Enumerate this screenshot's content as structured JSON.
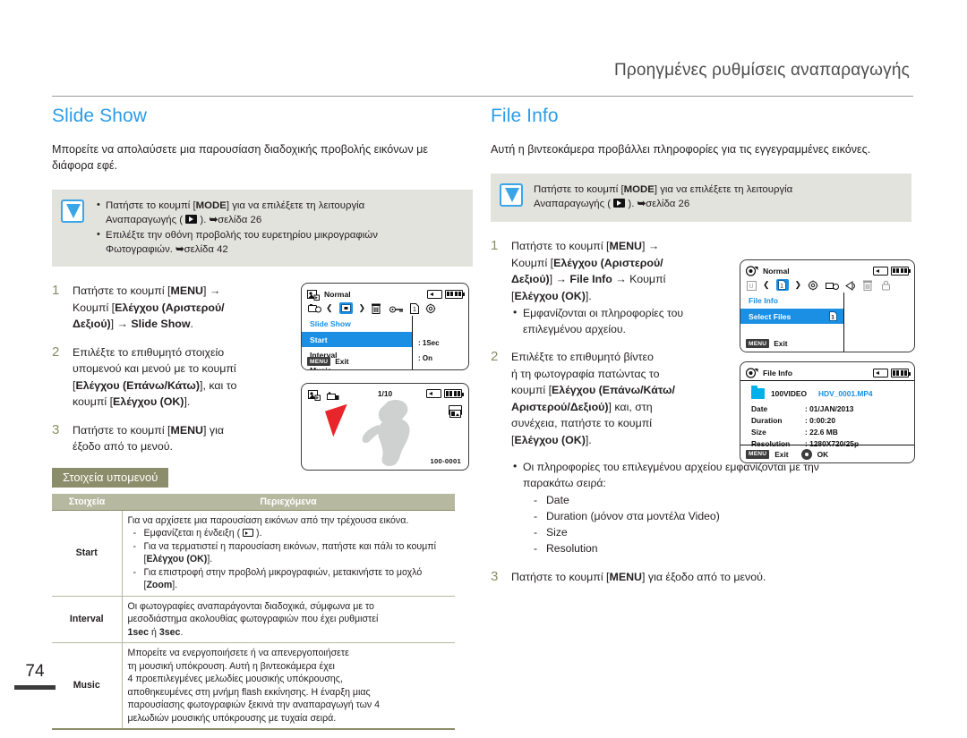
{
  "header": {
    "title": "Προηγμένες ρυθμίσεις αναπαραγωγής"
  },
  "page_number": "74",
  "colors": {
    "accent": "#2b9de8",
    "lcd_highlight": "#1a8fe3",
    "table_header": "#b7b8a0",
    "tag": "#8c8d6a"
  },
  "left": {
    "section_title": "Slide Show",
    "intro": "Μπορείτε να απολαύσετε μια παρουσίαση διαδοχικής προβολής εικόνων με διάφορα εφέ.",
    "note_items": [
      "Πατήστε το κουμπί [MODE] για να επιλέξετε τη λειτουργία Αναπαραγωγής (  ). ➥σελίδα 26",
      "Επιλέξτε την οθόνη προβολής του ευρετηρίου μικρογραφιών Φωτογραφιών. ➥σελίδα 42"
    ],
    "steps": [
      {
        "num": "1",
        "text": "Πατήστε το κουμπί [MENU] → Κουμπί [Ελέγχου (Αριστερού/Δεξιού)] → Slide Show."
      },
      {
        "num": "2",
        "text": "Επιλέξτε το επιθυμητό στοιχείο υπομενού και μενού με το κουμπί [Ελέγχου (Επάνω/Κάτω)], και το κουμπί [Ελέγχου (OK)]."
      },
      {
        "num": "3",
        "text": "Πατήστε το κουμπί [MENU] για έξοδο από το μενού."
      }
    ],
    "lcd_menu": {
      "mode_label": "Normal",
      "menu_title": "Slide Show",
      "items": [
        {
          "label": "Start",
          "value": "",
          "active": true
        },
        {
          "label": "Interval",
          "value": ": 1Sec",
          "active": false
        },
        {
          "label": "Music",
          "value": ": On",
          "active": false
        }
      ],
      "exit_button": "MENU",
      "exit_label": "Exit"
    },
    "lcd_preview": {
      "counter": "1/10",
      "file_number": "100-0001"
    },
    "submenu_tag": "Στοιχεία υπομενού",
    "table": {
      "headers": [
        "Στοιχεία",
        "Περιεχόμενα"
      ],
      "rows": [
        {
          "item": "Start",
          "lead": "Για να αρχίσετε μια παρουσίαση εικόνων από την τρέχουσα εικόνα.",
          "dashes": [
            "Εμφανίζεται η ένδειξη (  ).",
            "Για να τερματιστεί η παρουσίαση εικόνων, πατήστε και πάλι το κουμπί [Ελέγχου (OK)].",
            "Για επιστροφή στην προβολή μικρογραφιών, μετακινήστε το μοχλό [Zoom]."
          ]
        },
        {
          "item": "Interval",
          "lead": "Οι φωτογραφίες αναπαράγονται διαδοχικά, σύμφωνα με το μεσοδιάστημα ακολουθίας φωτογραφιών που έχει ρυθμιστεί 1sec ή 3sec.",
          "dashes": []
        },
        {
          "item": "Music",
          "lead": "Μπορείτε να ενεργοποιήσετε ή να απενεργοποιήσετε τη μουσική υπόκρουση. Αυτή η βιντεοκάμερα έχει 4 προεπιλεγμένες μελωδίες μουσικής υπόκρουσης, αποθηκευμένες στη μνήμη flash εκκίνησης. Η έναρξη μιας παρουσίασης φωτογραφιών ξεκινά την αναπαραγωγή των 4 μελωδιών μουσικής υπόκρουσης με τυχαία σειρά.",
          "dashes": []
        }
      ]
    }
  },
  "right": {
    "section_title": "File Info",
    "intro": "Αυτή η βιντεοκάμερα προβάλλει πληροφορίες για τις εγγεγραμμένες εικόνες.",
    "note_items": [
      "Πατήστε το κουμπί [MODE] για να επιλέξετε τη λειτουργία Αναπαραγωγής (  ). ➥σελίδα 26"
    ],
    "steps": [
      {
        "num": "1",
        "text": "Πατήστε το κουμπί [MENU] → Κουμπί [Ελέγχου (Αριστερού/Δεξιού)] → File Info → Κουμπί [Ελέγχου (OK)].",
        "bullets": [
          "Εμφανίζονται οι πληροφορίες του επιλεγμένου αρχείου."
        ]
      },
      {
        "num": "2",
        "text": "Επιλέξτε το επιθυμητό βίντεο ή τη φωτογραφία πατώντας το κουμπί [Ελέγχου (Επάνω/Κάτω/Αριστερού/Δεξιού)] και, στη συνέχεια, πατήστε το κουμπί [Ελέγχου (OK)].",
        "bullets": [
          "Οι πληροφορίες του επιλεγμένου αρχείου εμφανίζονται με την παρακάτω σειρά:"
        ],
        "dashes": [
          "Date",
          "Duration (μόνον στα μοντέλα Video)",
          "Size",
          "Resolution"
        ]
      },
      {
        "num": "3",
        "text": "Πατήστε το κουμπί [MENU] για έξοδο από το μενού.",
        "bullets": [],
        "dashes": []
      }
    ],
    "lcd_menu": {
      "mode_label": "Normal",
      "menu_title": "File Info",
      "items": [
        {
          "label": "Select Files",
          "active": true
        }
      ],
      "exit_button": "MENU",
      "exit_label": "Exit"
    },
    "lcd_fileinfo": {
      "title": "File Info",
      "folder": "100VIDEO",
      "file": "HDV_0001.MP4",
      "rows": [
        {
          "label": "Date",
          "value": ": 01/JAN/2013"
        },
        {
          "label": "Duration",
          "value": ": 0:00:20"
        },
        {
          "label": "Size",
          "value": ": 22.6 MB"
        },
        {
          "label": "Resolution",
          "value": ": 1280X720/25p"
        }
      ],
      "exit_button": "MENU",
      "exit_label": "Exit",
      "ok_label": "OK"
    }
  }
}
